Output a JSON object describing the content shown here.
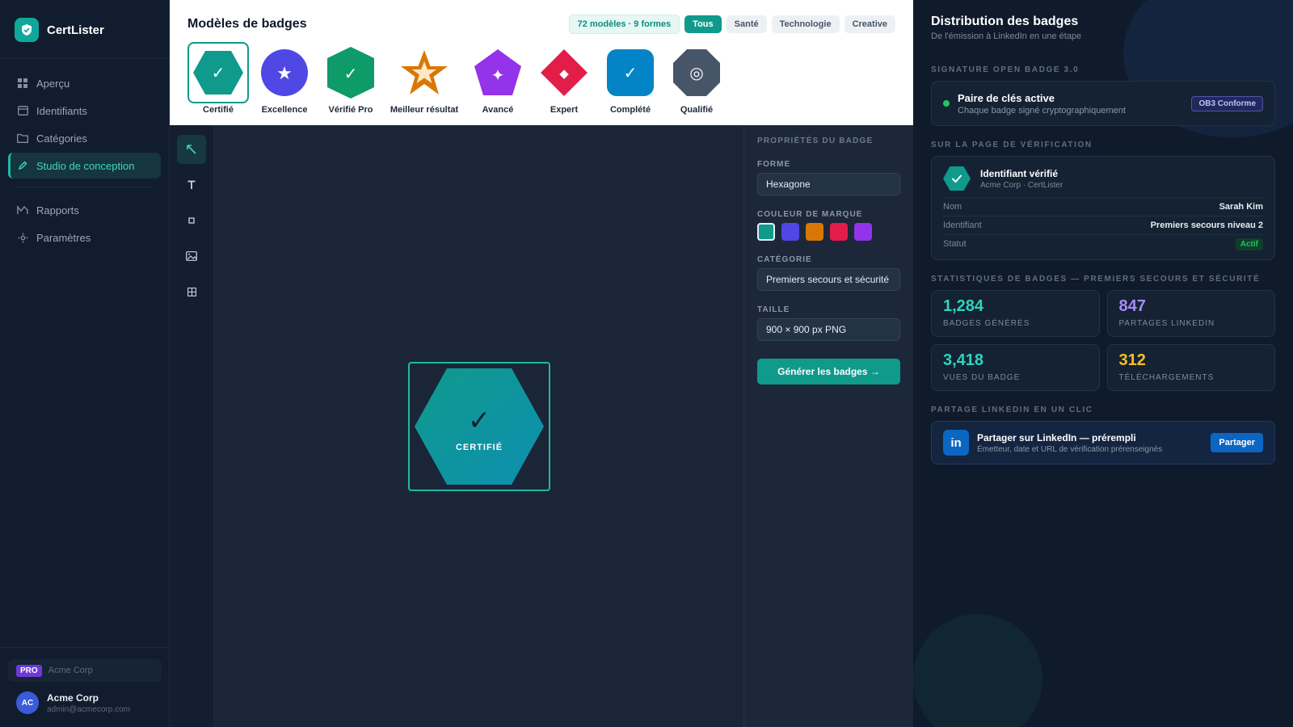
{
  "app": {
    "name": "CertLister"
  },
  "colors": {
    "accent": "#0f9a8c",
    "sidebar_active": "#3fd6c5",
    "linkedin": "#0a66c2"
  },
  "sidebar": {
    "items": [
      {
        "label": "Aperçu",
        "icon": "grid-icon"
      },
      {
        "label": "Identifiants",
        "icon": "card-icon"
      },
      {
        "label": "Catégories",
        "icon": "folder-icon"
      },
      {
        "label": "Studio de conception",
        "icon": "pen-icon",
        "active": true
      },
      {
        "label": "Rapports",
        "icon": "chart-icon"
      },
      {
        "label": "Paramètres",
        "icon": "gear-icon"
      }
    ],
    "plan": {
      "badge": "PRO",
      "org": "Acme Corp"
    },
    "user": {
      "initials": "AC",
      "name": "Acme Corp",
      "email": "admin@acmecorp.com"
    }
  },
  "templates": {
    "title": "Modèles de badges",
    "count": "72 modèles · 9 formes",
    "filters": [
      "Tous",
      "Santé",
      "Technologie",
      "Creative"
    ],
    "active_filter": "Tous",
    "items": [
      {
        "label": "Certifié",
        "shape": "hexagon",
        "color": "#0f9a8c",
        "glyph": "✓"
      },
      {
        "label": "Excellence",
        "shape": "circle",
        "color": "#5048e5",
        "glyph": "★"
      },
      {
        "label": "Vérifié Pro",
        "shape": "shield",
        "color": "#0f9a6a",
        "glyph": "✓"
      },
      {
        "label": "Meilleur résultat",
        "shape": "star",
        "color": "#d97706",
        "glyph": ""
      },
      {
        "label": "Avancé",
        "shape": "pentagon",
        "color": "#9333ea",
        "glyph": "✦"
      },
      {
        "label": "Expert",
        "shape": "diamond",
        "color": "#e11d48",
        "glyph": "◆"
      },
      {
        "label": "Complété",
        "shape": "rounded-square",
        "color": "#0284c7",
        "glyph": "✓"
      },
      {
        "label": "Qualifié",
        "shape": "octagon",
        "color": "#475569",
        "glyph": "◎"
      }
    ]
  },
  "tools": [
    "select-tool",
    "text-tool",
    "shape-tool",
    "image-tool",
    "grid-tool"
  ],
  "canvas": {
    "badge_text": "CERTIFIÉ",
    "badge_glyph": "✓"
  },
  "properties": {
    "title": "PROPRIÉTÉS DU BADGE",
    "shape_label": "FORME",
    "shape_value": "Hexagone",
    "color_label": "COULEUR DE MARQUE",
    "swatches": [
      "#0f9a8c",
      "#4f46e5",
      "#d97706",
      "#e11d48",
      "#9333ea"
    ],
    "category_label": "CATÉGORIE",
    "category_value": "Premiers secours et sécurité",
    "size_label": "TAILLE",
    "size_value": "900 × 900 px PNG",
    "generate_label": "Générer les badges →"
  },
  "right_panel": {
    "title": "Distribution des badges",
    "subtitle": "De l'émission à LinkedIn en une étape",
    "signature": {
      "section": "SIGNATURE OPEN BADGE 3.0",
      "title": "Paire de clés active",
      "subtitle": "Chaque badge signé cryptographiquement",
      "badge": "OB3 Conforme"
    },
    "verification": {
      "section": "SUR LA PAGE DE VÉRIFICATION",
      "title": "Identifiant vérifié",
      "subtitle": "Acme Corp · CertLister",
      "rows": [
        {
          "key": "Nom",
          "value": "Sarah Kim"
        },
        {
          "key": "Identifiant",
          "value": "Premiers secours niveau 2"
        },
        {
          "key": "Statut",
          "value": "Actif"
        }
      ]
    },
    "stats": {
      "section": "STATISTIQUES DE BADGES — PREMIERS SECOURS ET SÉCURITÉ",
      "items": [
        {
          "value": "1,284",
          "label": "BADGES GÉNÉRÉS",
          "color": "#2dd4bf"
        },
        {
          "value": "847",
          "label": "PARTAGES LINKEDIN",
          "color": "#a78bfa"
        },
        {
          "value": "3,418",
          "label": "VUES DU BADGE",
          "color": "#2dd4bf"
        },
        {
          "value": "312",
          "label": "TÉLÉCHARGEMENTS",
          "color": "#fbbf24"
        }
      ]
    },
    "linkedin": {
      "section": "PARTAGE LINKEDIN EN UN CLIC",
      "logo": "in",
      "title": "Partager sur LinkedIn — prérempli",
      "subtitle": "Émetteur, date et URL de vérification prérenseignés",
      "button": "Partager"
    }
  }
}
